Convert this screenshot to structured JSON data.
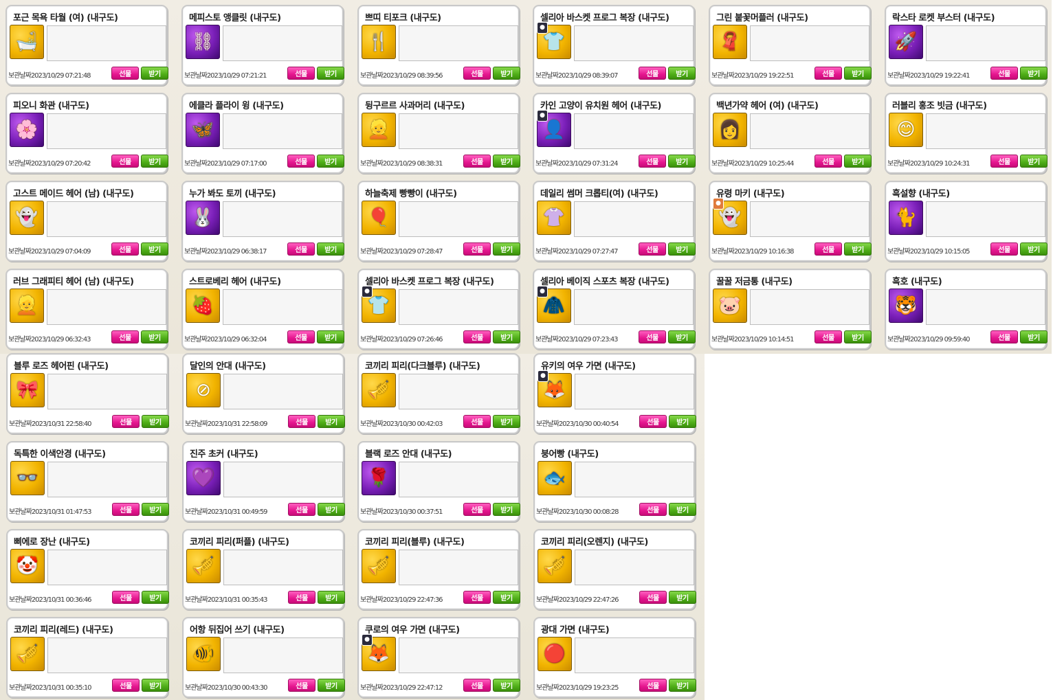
{
  "labels": {
    "storage_date": "보관날짜",
    "gift": "선물",
    "receive": "받기"
  },
  "items": [
    {
      "name": "포근 목욕 타월 (여) (내구도)",
      "date": "2023/10/29 07:21:48",
      "icon": "towel-icon",
      "glyph": "🛁",
      "bg": "gold"
    },
    {
      "name": "메피스토 앵클릿 (내구도)",
      "date": "2023/10/29 07:21:21",
      "icon": "anklet-icon",
      "glyph": "⛓",
      "bg": "purple"
    },
    {
      "name": "쁘띠 티포크 (내구도)",
      "date": "2023/10/29 08:39:56",
      "icon": "fork-icon",
      "glyph": "🍴",
      "bg": "gold"
    },
    {
      "name": "셀리아 바스켓 프로그 복장 (내구도)",
      "date": "2023/10/29 08:39:07",
      "icon": "outfit-icon",
      "glyph": "👕",
      "bg": "gold",
      "avatar": true
    },
    {
      "name": "그린 붙꽃머플러 (내구도)",
      "date": "2023/10/29 19:22:51",
      "icon": "muffler-icon",
      "glyph": "🧣",
      "bg": "gold"
    },
    {
      "name": "락스타 로켓 부스터 (내구도)",
      "date": "2023/10/29 19:22:41",
      "icon": "booster-icon",
      "glyph": "🚀",
      "bg": "purple"
    },
    {
      "name": "피오니 화관 (내구도)",
      "date": "2023/10/29 07:20:42",
      "icon": "flower-crown-icon",
      "glyph": "🌸",
      "bg": "purple"
    },
    {
      "name": "에클라 플라이 윙 (내구도)",
      "date": "2023/10/29 07:17:00",
      "icon": "wing-icon",
      "glyph": "🦋",
      "bg": "purple"
    },
    {
      "name": "뒹구르르 사과머리 (내구도)",
      "date": "2023/10/29 08:38:31",
      "icon": "hair-icon",
      "glyph": "👱",
      "bg": "gold"
    },
    {
      "name": "카인 고양이 유치원 헤어 (내구도)",
      "date": "2023/10/29 07:31:24",
      "icon": "hair-icon",
      "glyph": "👤",
      "bg": "purple",
      "avatar": true
    },
    {
      "name": "백년가약 헤어 (여) (내구도)",
      "date": "2023/10/29 10:25:44",
      "icon": "hair-icon",
      "glyph": "👩",
      "bg": "gold"
    },
    {
      "name": "러블리 홍조 빗금 (내구도)",
      "date": "2023/10/29 10:24:31",
      "icon": "blush-icon",
      "glyph": "😊",
      "bg": "gold"
    },
    {
      "name": "고스트 메이드 헤어 (남) (내구도)",
      "date": "2023/10/29 07:04:09",
      "icon": "hair-icon",
      "glyph": "👻",
      "bg": "gold"
    },
    {
      "name": "누가 봐도 토끼 (내구도)",
      "date": "2023/10/29 06:38:17",
      "icon": "rabbit-icon",
      "glyph": "🐰",
      "bg": "purple"
    },
    {
      "name": "하늘축제 빵빵이 (내구도)",
      "date": "2023/10/29 07:28:47",
      "icon": "balloon-icon",
      "glyph": "🎈",
      "bg": "gold"
    },
    {
      "name": "데일리 썸머 크롭티(여) (내구도)",
      "date": "2023/10/29 07:27:47",
      "icon": "shirt-icon",
      "glyph": "👚",
      "bg": "gold"
    },
    {
      "name": "유령 마키 (내구도)",
      "date": "2023/10/29 10:16:38",
      "icon": "ghost-icon",
      "glyph": "👻",
      "bg": "gold",
      "avatar": true,
      "avatar_color": "orange"
    },
    {
      "name": "흑설향 (내구도)",
      "date": "2023/10/29 10:15:05",
      "icon": "cat-icon",
      "glyph": "🐈",
      "bg": "purple"
    },
    {
      "name": "러브 그래피티 헤어 (남) (내구도)",
      "date": "2023/10/29 06:32:43",
      "icon": "hair-icon",
      "glyph": "👱",
      "bg": "gold"
    },
    {
      "name": "스트로베리 헤어 (내구도)",
      "date": "2023/10/29 06:32:04",
      "icon": "hair-icon",
      "glyph": "🍓",
      "bg": "gold"
    },
    {
      "name": "셀리아 바스켓 프로그 복장 (내구도)",
      "date": "2023/10/29 07:26:46",
      "icon": "outfit-icon",
      "glyph": "👕",
      "bg": "gold",
      "avatar": true
    },
    {
      "name": "셀리아 베이직 스포츠 복장 (내구도)",
      "date": "2023/10/29 07:23:43",
      "icon": "outfit-icon",
      "glyph": "🧥",
      "bg": "gold",
      "avatar": true
    },
    {
      "name": "꿀꿀 저금통 (내구도)",
      "date": "2023/10/29 10:14:51",
      "icon": "piggy-bank-icon",
      "glyph": "🐷",
      "bg": "gold"
    },
    {
      "name": "흑호 (내구도)",
      "date": "2023/10/29 09:59:40",
      "icon": "tiger-icon",
      "glyph": "🐯",
      "bg": "purple"
    },
    {
      "name": "블루 로즈 헤어핀 (내구도)",
      "date": "2023/10/31 22:58:40",
      "icon": "hairpin-icon",
      "glyph": "🎀",
      "bg": "gold"
    },
    {
      "name": "달인의 안대 (내구도)",
      "date": "2023/10/31 22:58:09",
      "icon": "eyepatch-icon",
      "glyph": "⊘",
      "bg": "gold"
    },
    {
      "name": "코끼리 피리(다크블루) (내구도)",
      "date": "2023/10/30 00:42:03",
      "icon": "flute-icon",
      "glyph": "🎺",
      "bg": "gold"
    },
    {
      "name": "유키의 여우 가면 (내구도)",
      "date": "2023/10/30 00:40:54",
      "icon": "fox-mask-icon",
      "glyph": "🦊",
      "bg": "gold",
      "avatar": true
    },
    {
      "name": "독특한 이색안경 (내구도)",
      "date": "2023/10/31 01:47:53",
      "icon": "glasses-icon",
      "glyph": "👓",
      "bg": "gold"
    },
    {
      "name": "진주 초커 (내구도)",
      "date": "2023/10/31 00:49:59",
      "icon": "choker-icon",
      "glyph": "💜",
      "bg": "purple"
    },
    {
      "name": "블랙 로즈 안대 (내구도)",
      "date": "2023/10/30 00:37:51",
      "icon": "eyepatch-icon",
      "glyph": "🌹",
      "bg": "purple"
    },
    {
      "name": "붕어빵 (내구도)",
      "date": "2023/10/30 00:08:28",
      "icon": "fish-bread-icon",
      "glyph": "🐟",
      "bg": "gold"
    },
    {
      "name": "삐에로 장난 (내구도)",
      "date": "2023/10/31 00:36:46",
      "icon": "clown-icon",
      "glyph": "🤡",
      "bg": "gold"
    },
    {
      "name": "코끼리 피리(퍼플) (내구도)",
      "date": "2023/10/31 00:35:43",
      "icon": "flute-icon",
      "glyph": "🎺",
      "bg": "gold"
    },
    {
      "name": "코끼리 피리(블루) (내구도)",
      "date": "2023/10/29 22:47:36",
      "icon": "flute-icon",
      "glyph": "🎺",
      "bg": "gold"
    },
    {
      "name": "코끼리 피리(오렌지) (내구도)",
      "date": "2023/10/29 22:47:26",
      "icon": "flute-icon",
      "glyph": "🎺",
      "bg": "gold"
    },
    {
      "name": "코끼리 피리(레드) (내구도)",
      "date": "2023/10/31 00:35:10",
      "icon": "flute-icon",
      "glyph": "🎺",
      "bg": "gold"
    },
    {
      "name": "어항 뒤집어 쓰기 (내구도)",
      "date": "2023/10/30 00:43:30",
      "icon": "fishbowl-icon",
      "glyph": "🐠",
      "bg": "gold"
    },
    {
      "name": "쿠로의 여우 가면 (내구도)",
      "date": "2023/10/29 22:47:12",
      "icon": "fox-mask-icon",
      "glyph": "🦊",
      "bg": "gold",
      "avatar": true
    },
    {
      "name": "광대 가면 (내구도)",
      "date": "2023/10/29 19:23:25",
      "icon": "clown-mask-icon",
      "glyph": "🔴",
      "bg": "gold"
    }
  ]
}
